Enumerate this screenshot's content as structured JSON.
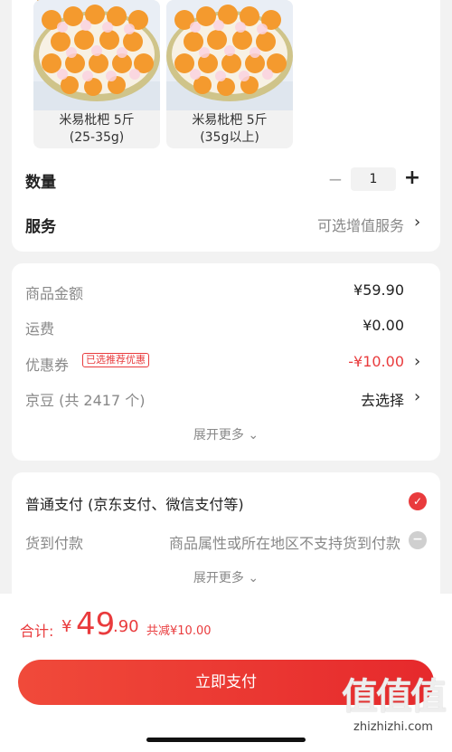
{
  "product": {
    "skus": [
      {
        "name": "米易枇杷 5斤",
        "spec": "(25-35g)"
      },
      {
        "name": "米易枇杷 5斤",
        "spec": "(35g以上)"
      }
    ],
    "quantity_label": "数量",
    "quantity_value": "1",
    "minus_symbol": "−",
    "plus_symbol": "+",
    "service_label": "服务",
    "service_value": "可选增值服务"
  },
  "price": {
    "goods_amount_label": "商品金额",
    "goods_amount_value": "¥59.90",
    "shipping_label": "运费",
    "shipping_value": "¥0.00",
    "coupon_label": "优惠券",
    "coupon_tag": "已选推荐优惠",
    "coupon_value": "-¥10.00",
    "jingdou_label": "京豆 (共 2417 个)",
    "jingdou_value": "去选择",
    "more_label": "展开更多 ⌄"
  },
  "payment": {
    "normal_label": "普通支付 (京东支付、微信支付等)",
    "cod_label": "货到付款",
    "cod_note": "商品属性或所在地区不支持货到付款",
    "more_label": "展开更多 ⌄"
  },
  "footer": {
    "total_label": "合计:",
    "currency": "¥",
    "total_integer": "49",
    "total_decimal": ".90",
    "discount_text": "共减¥10.00",
    "pay_button": "立即支付"
  },
  "watermark": {
    "logo_text": "值值值",
    "site_text": "zhizhizhi.com"
  },
  "colors": {
    "accent_red": "#e93b3d",
    "background": "#f2f2f2"
  }
}
